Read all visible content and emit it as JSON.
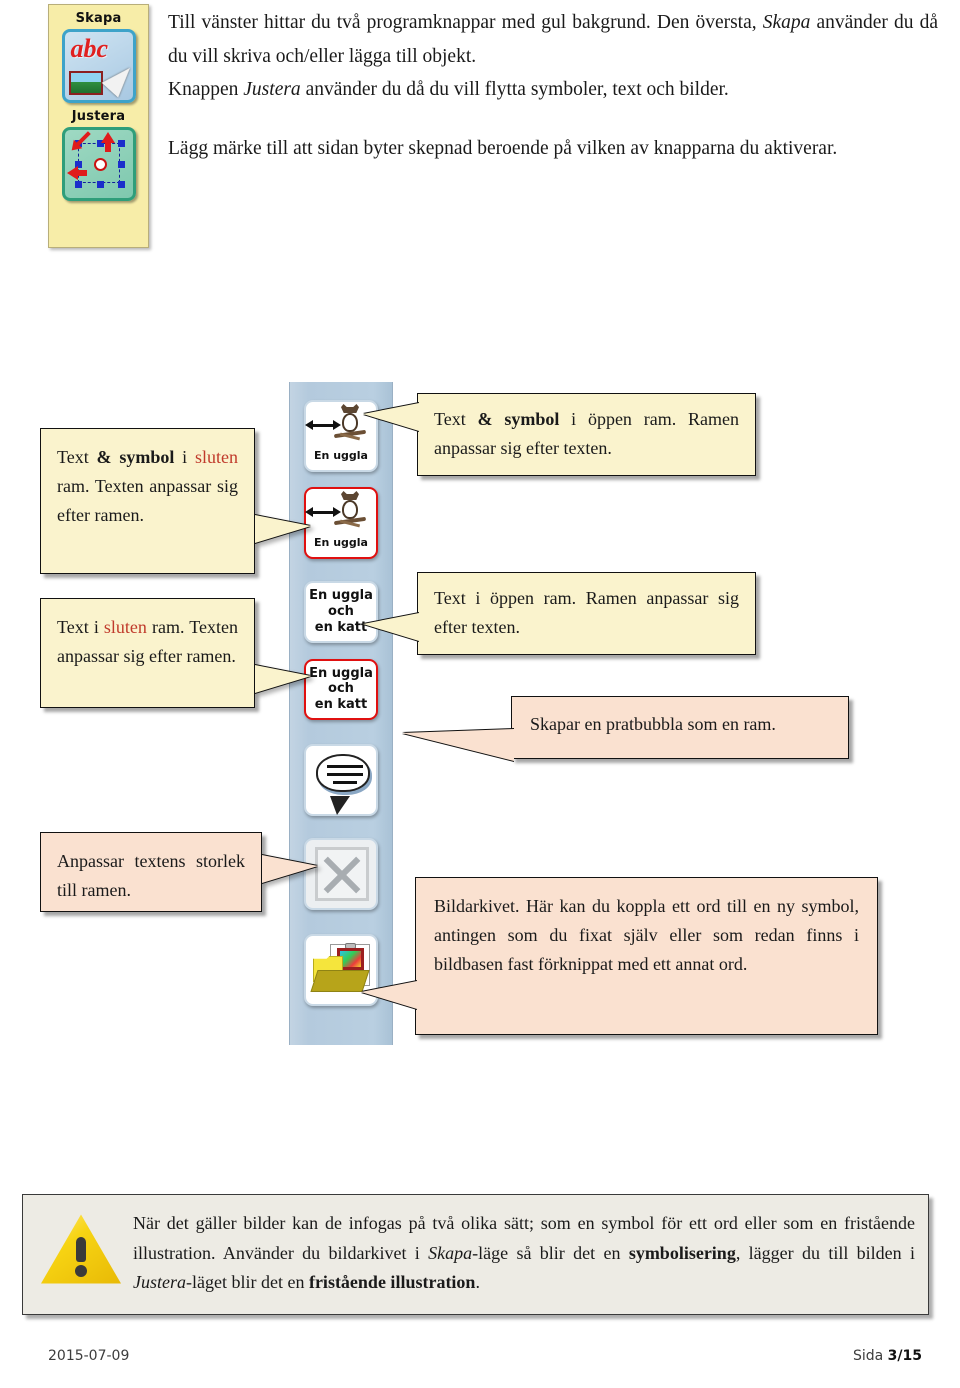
{
  "document": {
    "intro": {
      "paragraph1_part1": "Till vänster hittar du två programknappar med gul bakgrund. Den översta, ",
      "paragraph1_italic": "Skapa",
      "paragraph1_part2": " använder du då du vill skriva och/eller lägga till objekt.",
      "paragraph1_line3_part1": "Knappen ",
      "paragraph1_line3_italic": "Justera",
      "paragraph1_line3_part2": " använder du då du vill flytta symboler, text och bilder.",
      "paragraph2": "Lägg märke till att sidan byter skepnad beroende på vilken av knapparna du aktiverar."
    },
    "program_panel": {
      "buttons": [
        {
          "label": "Skapa",
          "icon": "abc-pencil-picture-icon"
        },
        {
          "label": "Justera",
          "icon": "move-arrows-selection-icon"
        }
      ]
    },
    "toolbar": {
      "buttons": [
        {
          "name": "text-symbol-open-frame",
          "caption": "En uggla",
          "icon": "owl-symbol-icon",
          "state": "open"
        },
        {
          "name": "text-symbol-closed-frame",
          "caption": "En uggla",
          "icon": "owl-symbol-icon",
          "state": "closed"
        },
        {
          "name": "text-open-frame",
          "caption": "En uggla\noch\nen katt",
          "lines": [
            "En uggla",
            "och",
            "en katt"
          ],
          "state": "open"
        },
        {
          "name": "text-closed-frame",
          "caption": "En uggla\noch\nen katt",
          "lines": [
            "En uggla",
            "och",
            "en katt"
          ],
          "state": "closed"
        },
        {
          "name": "speech-bubble-frame",
          "icon": "speech-bubble-icon"
        },
        {
          "name": "fit-text-to-frame",
          "icon": "resize-arrows-icon"
        },
        {
          "name": "image-library",
          "icon": "image-library-folder-icon"
        }
      ]
    },
    "callouts": {
      "left_top": {
        "segments": [
          {
            "text": "Text ",
            "style": "normal"
          },
          {
            "text": "& symbol",
            "style": "bold"
          },
          {
            "text": " i ",
            "style": "normal"
          },
          {
            "text": "sluten",
            "style": "red"
          },
          {
            "text": " ram. Texten anpassar sig efter ramen.",
            "style": "normal"
          }
        ],
        "color": "#faf3cd"
      },
      "left_second": {
        "segments": [
          {
            "text": "Text i ",
            "style": "normal"
          },
          {
            "text": "sluten",
            "style": "red"
          },
          {
            "text": " ram. Texten anpassar sig efter ramen.",
            "style": "normal"
          }
        ],
        "color": "#faf3cd"
      },
      "left_third": {
        "text": "Anpassar textens storlek till ramen.",
        "color": "#fae1d0"
      },
      "right_top": {
        "segments": [
          {
            "text": "Text ",
            "style": "normal"
          },
          {
            "text": "& symbol",
            "style": "bold"
          },
          {
            "text": " i öppen ram. Ramen anpassar sig efter texten.",
            "style": "normal"
          }
        ],
        "color": "#faf3cd"
      },
      "right_second": {
        "text": "Text i öppen ram. Ramen anpassar sig efter texten.",
        "color": "#faf3cd"
      },
      "right_third": {
        "text": "Skapar en pratbubbla som en ram.",
        "color": "#fae1d0"
      },
      "right_fourth": {
        "text": "Bildarkivet. Här kan du koppla ett ord till en ny symbol, antingen som du fixat själv eller som redan finns i bildbasen fast förknippat med ett annat ord.",
        "color": "#fae1d0"
      }
    },
    "warning": {
      "icon": "warning-triangle-icon",
      "part1": "När det gäller bilder kan de infogas på två olika sätt; som en symbol för ett ord eller som en fristående illustration. Använder du bildarkivet i ",
      "italic1": "Skapa",
      "part2": "-läge så blir det en ",
      "bold1": "symbolisering",
      "part3": ", lägger du till bilden i ",
      "italic2": "Justera",
      "part4": "-läget blir det en ",
      "bold2": "fristående illustration",
      "part5": "."
    },
    "footer": {
      "date": "2015-07-09",
      "page_label": "Sida ",
      "page_number": "3/15"
    }
  }
}
